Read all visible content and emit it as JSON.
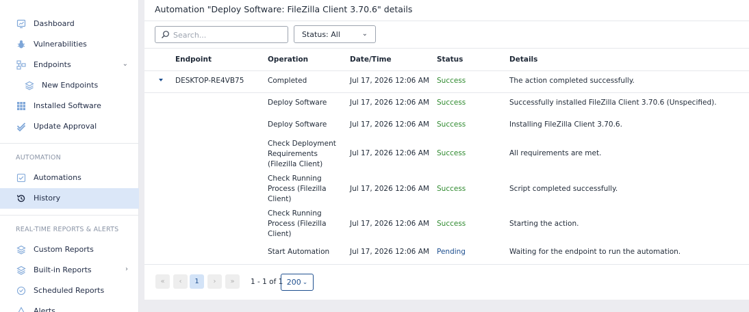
{
  "sidebar": {
    "items": [
      {
        "label": "Dashboard",
        "icon": "dashboard-icon"
      },
      {
        "label": "Vulnerabilities",
        "icon": "bug-icon"
      },
      {
        "label": "Endpoints",
        "icon": "endpoints-icon",
        "expanded": true
      },
      {
        "label": "New Endpoints",
        "icon": "layers-icon"
      },
      {
        "label": "Installed Software",
        "icon": "grid-icon"
      },
      {
        "label": "Update Approval",
        "icon": "check-icon"
      }
    ],
    "automation_section": "AUTOMATION",
    "automation_items": [
      {
        "label": "Automations",
        "icon": "automation-icon"
      },
      {
        "label": "History",
        "icon": "history-icon",
        "active": true
      }
    ],
    "reports_section": "REAL-TIME REPORTS & ALERTS",
    "reports_items": [
      {
        "label": "Custom Reports",
        "icon": "layers-icon"
      },
      {
        "label": "Built-in Reports",
        "icon": "layers-icon"
      },
      {
        "label": "Scheduled Reports",
        "icon": "clock-icon"
      },
      {
        "label": "Alerts",
        "icon": "alert-icon"
      }
    ]
  },
  "main": {
    "title": "Automation \"Deploy Software: FileZilla Client 3.70.6\" details",
    "search_placeholder": "Search...",
    "status_filter": "Status: All",
    "columns": [
      "Endpoint",
      "Operation",
      "Date/Time",
      "Status",
      "Details"
    ],
    "parent_row": {
      "endpoint": "DESKTOP-RE4VB75",
      "operation": "Completed",
      "datetime": "Jul 17, 2026 12:06 AM",
      "status": "Success",
      "details": "The action completed successfully."
    },
    "child_rows": [
      {
        "operation": "Deploy Software",
        "datetime": "Jul 17, 2026 12:06 AM",
        "status": "Success",
        "details": "Successfully installed FileZilla Client 3.70.6 (Unspecified)."
      },
      {
        "operation": "Deploy Software",
        "datetime": "Jul 17, 2026 12:06 AM",
        "status": "Success",
        "details": "Installing FileZilla Client 3.70.6."
      },
      {
        "operation": "Check Deployment Requirements (Filezilla Client)",
        "datetime": "Jul 17, 2026 12:06 AM",
        "status": "Success",
        "details": "All requirements are met."
      },
      {
        "operation": "Check Running Process (Filezilla Client)",
        "datetime": "Jul 17, 2026 12:06 AM",
        "status": "Success",
        "details": "Script completed successfully."
      },
      {
        "operation": "Check Running Process (Filezilla Client)",
        "datetime": "Jul 17, 2026 12:06 AM",
        "status": "Success",
        "details": "Starting the action."
      },
      {
        "operation": "Start Automation",
        "datetime": "Jul 17, 2026 12:06 AM",
        "status": "Pending",
        "details": "Waiting for the endpoint to run the automation."
      }
    ],
    "pagination": {
      "first": "«",
      "prev": "‹",
      "current_page": "1",
      "next": "›",
      "last": "»",
      "count": "1 - 1 of 1",
      "page_size": "200"
    }
  },
  "colors": {
    "success": "#2f8a2f",
    "pending": "#1e4f8f",
    "active_nav": "#dbe7f8",
    "accent": "#1e4f8f"
  }
}
